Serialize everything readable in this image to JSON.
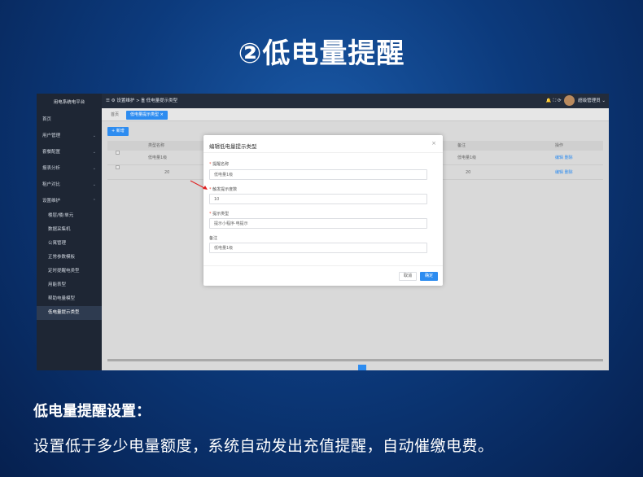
{
  "headline": "②低电量提醒",
  "app": {
    "brand": "用电系统电平台",
    "sidebar": {
      "items": [
        {
          "label": "首页",
          "arrow": ""
        },
        {
          "label": "用户管理",
          "arrow": "⌄"
        },
        {
          "label": "套餐配置",
          "arrow": "⌄"
        },
        {
          "label": "报表分析",
          "arrow": "⌄"
        },
        {
          "label": "租户对比",
          "arrow": "⌄"
        },
        {
          "label": "设置维护",
          "arrow": "⌃"
        }
      ],
      "subitems": [
        {
          "label": "楼层/楼/单元"
        },
        {
          "label": "数据采集机"
        },
        {
          "label": "公寓管理"
        },
        {
          "label": "正常参数模板"
        },
        {
          "label": "定时提醒电类型"
        },
        {
          "label": "用能表型"
        },
        {
          "label": "帮助电量模型"
        },
        {
          "label": "低电量提示类型"
        }
      ]
    },
    "topbar": {
      "breadcrumb": "☰  ⚙ 设置维护  >  🖹 低电量提示类型",
      "icons": "🔔  ⛶  ⟳",
      "user": "超级管理员 ⌄"
    },
    "tabs": {
      "home": "首页",
      "current": "低电量提示类型  ×"
    },
    "add_button": "+ 新增",
    "table": {
      "headers": [
        "",
        "类型名称",
        "",
        "",
        "备注",
        "操作"
      ],
      "rows": [
        {
          "name": "低电量1级",
          "remark": "低电量1级",
          "ops": "编辑  删除"
        },
        {
          "name": "20",
          "remark": "20",
          "ops": "编辑  删除"
        }
      ]
    },
    "modal": {
      "title": "编辑低电量提示类型",
      "close": "×",
      "fields": [
        {
          "label": "提醒名称",
          "required": true,
          "value": "低电量1级"
        },
        {
          "label": "触发提示度数",
          "required": true,
          "value": "10"
        },
        {
          "label": "提示类型",
          "required": true,
          "value": "提示小程序·电提示"
        },
        {
          "label": "备注",
          "required": false,
          "value": "低电量1级"
        }
      ],
      "cancel": "取消",
      "ok": "确定"
    }
  },
  "subtitle": "低电量提醒设置：",
  "description": "设置低于多少电量额度，系统自动发出充值提醒，自动催缴电费。",
  "colors": {
    "accent": "#2d8cf0",
    "sidebar": "#1e2634",
    "background": "#0c3a7c"
  }
}
